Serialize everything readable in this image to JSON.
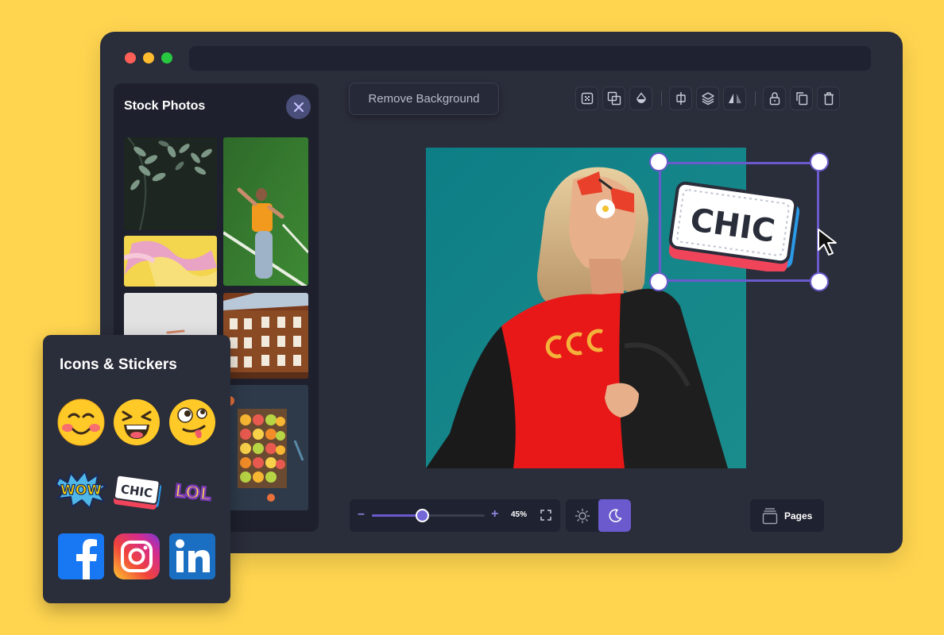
{
  "stock_photos": {
    "title": "Stock Photos"
  },
  "toolbar": {
    "remove_background_label": "Remove Background"
  },
  "sticker_text": "CHIC",
  "zoom": {
    "value_label": "45%",
    "level_percent": 45
  },
  "pages": {
    "label": "Pages"
  },
  "icons_stickers": {
    "title": "Icons & Stickers",
    "stickers": {
      "wow": "WOW",
      "chic": "CHIC",
      "lol": "LOL"
    }
  },
  "colors": {
    "background": "#FFD550",
    "window": "#2A2D3A",
    "accent": "#6A5ACD"
  }
}
